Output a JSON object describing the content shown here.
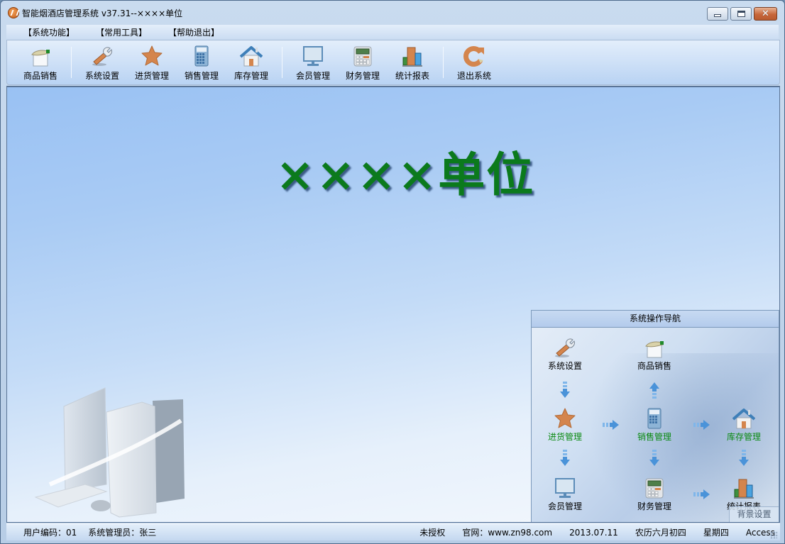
{
  "window": {
    "title": "智能烟酒店管理系统 v37.31--××××单位",
    "controls": {
      "minimize": "minimize",
      "maximize": "maximize",
      "close": "close"
    }
  },
  "menu": [
    {
      "label": "【系统功能】"
    },
    {
      "label": "【常用工具】"
    },
    {
      "label": "【帮助退出】"
    }
  ],
  "toolbar": [
    {
      "label": "商品销售",
      "icon": "hand-card-icon"
    },
    {
      "label": "系统设置",
      "icon": "wrench-icon"
    },
    {
      "label": "进货管理",
      "icon": "star-icon"
    },
    {
      "label": "销售管理",
      "icon": "calculator-icon"
    },
    {
      "label": "库存管理",
      "icon": "house-icon"
    },
    {
      "label": "会员管理",
      "icon": "monitor-icon"
    },
    {
      "label": "财务管理",
      "icon": "cash-register-icon"
    },
    {
      "label": "统计报表",
      "icon": "bar-chart-icon"
    },
    {
      "label": "退出系统",
      "icon": "exit-icon"
    }
  ],
  "main": {
    "unit_title": "××××单位"
  },
  "nav_panel": {
    "title": "系统操作导航",
    "items": {
      "system_settings": "系统设置",
      "product_sales": "商品销售",
      "purchase": "进货管理",
      "sales": "销售管理",
      "inventory": "库存管理",
      "members": "会员管理",
      "finance": "财务管理",
      "reports": "统计报表"
    },
    "bg_settings": "背景设置"
  },
  "status": {
    "user_code": "用户编码：01",
    "admin": "系统管理员：张三",
    "license": "未授权",
    "website": "官网：www.zn98.com",
    "date": "2013.07.11",
    "lunar": "农历六月初四",
    "weekday": "星期四",
    "db": "Access"
  },
  "colors": {
    "unit_title": "#0b7a1c",
    "icon_orange": "#d4854d",
    "nav_green_label": "#0b8a12"
  }
}
